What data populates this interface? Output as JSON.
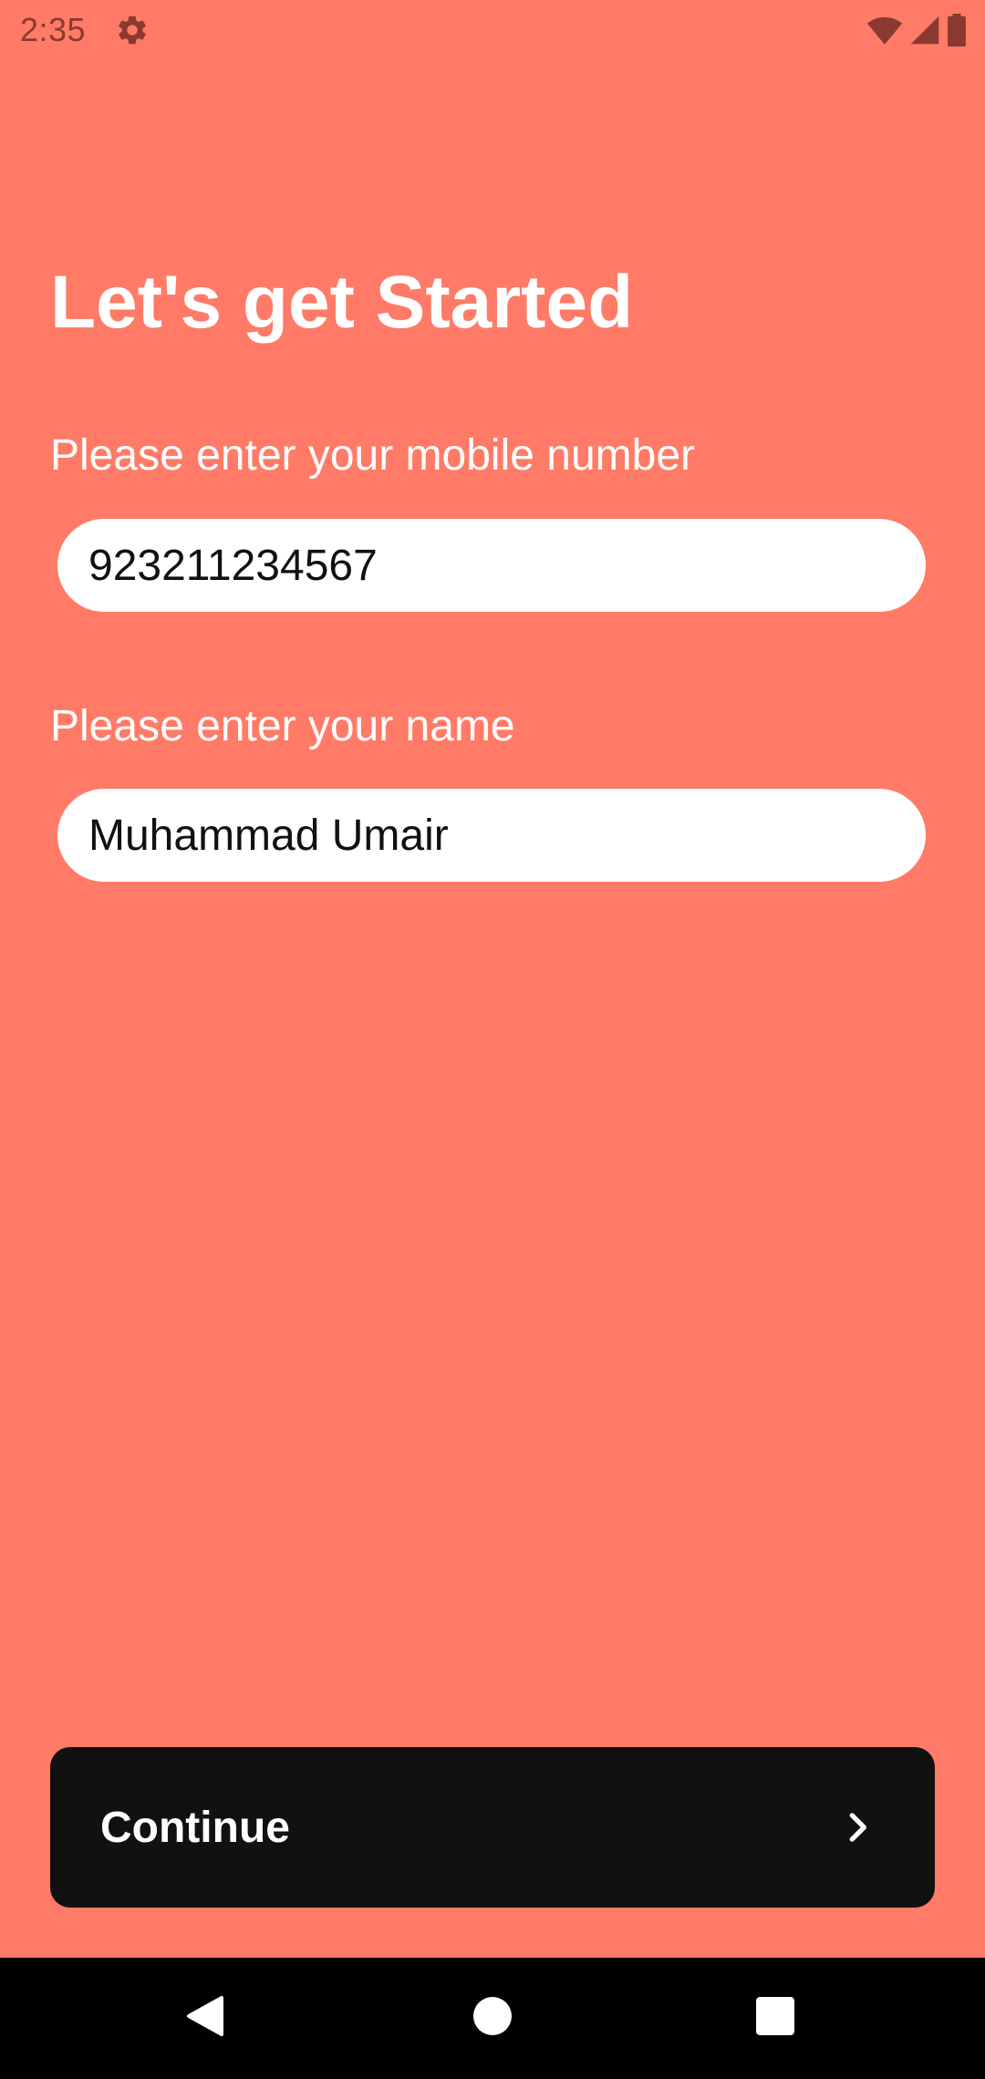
{
  "status_bar": {
    "time": "2:35",
    "icons": [
      "gear-icon",
      "wifi-icon",
      "signal-icon",
      "battery-icon"
    ],
    "icon_color": "#8A3A30"
  },
  "page": {
    "background": "#FF7B67",
    "title": "Let's get Started"
  },
  "form": {
    "mobile": {
      "label": "Please enter your mobile number",
      "value": "923211234567"
    },
    "name": {
      "label": "Please enter your name",
      "value": "Muhammad Umair"
    }
  },
  "continue_button": {
    "label": "Continue",
    "icon": "chevron-right-icon",
    "background": "#111111"
  },
  "nav_bar": {
    "items": [
      "back-icon",
      "home-icon",
      "recents-icon"
    ]
  }
}
